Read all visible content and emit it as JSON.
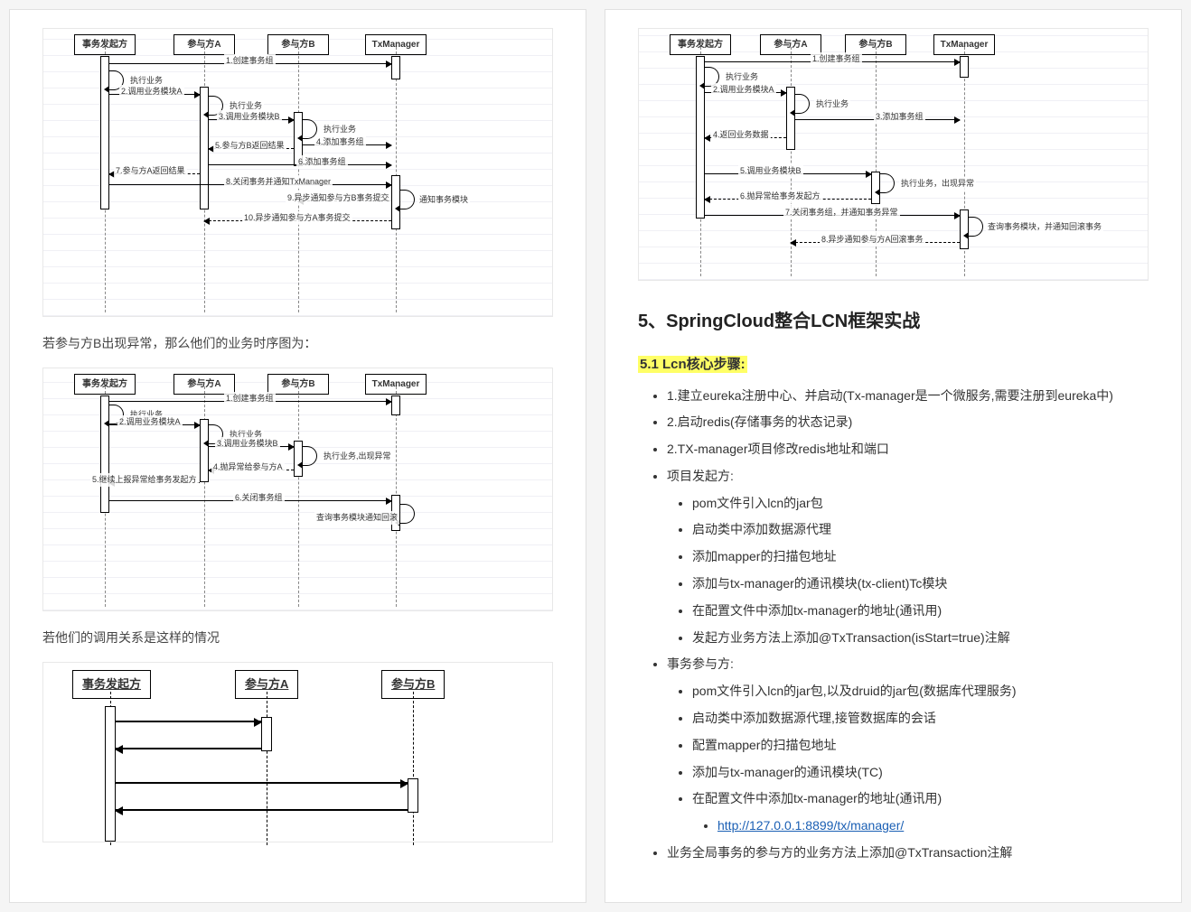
{
  "leftPage": {
    "diagram1": {
      "actors": [
        "事务发起方",
        "参与方A",
        "参与方B",
        "TxManager"
      ],
      "msgs": {
        "m1": "1.创建事务组",
        "m2": "执行业务",
        "m3": "2.调用业务模块A",
        "m4": "执行业务",
        "m5": "3.调用业务模块B",
        "m6": "执行业务",
        "m7": "4.添加事务组",
        "m8": "5.参与方B返回结果",
        "m9": "6.添加事务组",
        "m10": "7.参与方A返回结果",
        "m11": "8.关闭事务并通知TxManager",
        "m12": "9.异步通知参与方B事务提交",
        "m13": "通知事务模块",
        "m14": "10.异步通知参与方A事务提交"
      }
    },
    "para1": "若参与方B出现异常，那么他们的业务时序图为：",
    "diagram2": {
      "actors": [
        "事务发起方",
        "参与方A",
        "参与方B",
        "TxManager"
      ],
      "msgs": {
        "m1": "1.创建事务组",
        "m2": "执行业务",
        "m3": "2.调用业务模块A",
        "m4": "执行业务",
        "m5": "3.调用业务模块B",
        "m6": "执行业务,出现异常",
        "m7": "4.抛异常给参与方A",
        "m8": "5.继续上报异常给事务发起方",
        "m9": "6.关闭事务组",
        "m10": "查询事务模块通知回滚"
      }
    },
    "para2": "若他们的调用关系是这样的情况",
    "diagram3": {
      "actors": [
        "事务发起方",
        "参与方A",
        "参与方B"
      ]
    }
  },
  "rightPage": {
    "diagramRight": {
      "actors": [
        "事务发起方",
        "参与方A",
        "参与方B",
        "TxManager"
      ],
      "msgs": {
        "m1": "1.创建事务组",
        "m2": "执行业务",
        "m3": "2.调用业务模块A",
        "m4": "执行业务",
        "m5": "3.添加事务组",
        "m6": "4.返回业务数据",
        "m7": "5.调用业务模块B",
        "m8": "执行业务，出现异常",
        "m9": "6.抛异常给事务发起方",
        "m10": "7.关闭事务组，并通知事务异常",
        "m11": "查询事务模块，并通知回滚事务",
        "m12": "8.异步通知参与方A回滚事务"
      }
    },
    "sectionTitle": "5、SpringCloud整合LCN框架实战",
    "subTitle": "5.1 Lcn核心步骤:",
    "list": {
      "i1": "1.建立eureka注册中心、并启动(Tx-manager是一个微服务,需要注册到eureka中)",
      "i2": "2.启动redis(存储事务的状态记录)",
      "i3": "2.TX-manager项目修改redis地址和端口",
      "i4": "项目发起方:",
      "i4a": "pom文件引入lcn的jar包",
      "i4b": "启动类中添加数据源代理",
      "i4c": "添加mapper的扫描包地址",
      "i4d": "添加与tx-manager的通讯模块(tx-client)Tc模块",
      "i4e": "在配置文件中添加tx-manager的地址(通讯用)",
      "i4f": "发起方业务方法上添加@TxTransaction(isStart=true)注解",
      "i5": "事务参与方:",
      "i5a": "pom文件引入lcn的jar包,以及druid的jar包(数据库代理服务)",
      "i5b": "启动类中添加数据源代理,接管数据库的会话",
      "i5c": "配置mapper的扫描包地址",
      "i5d": "添加与tx-manager的通讯模块(TC)",
      "i5e": "在配置文件中添加tx-manager的地址(通讯用)",
      "i5eLink": "http://127.0.0.1:8899/tx/manager/",
      "i6": "业务全局事务的参与方的业务方法上添加@TxTransaction注解"
    }
  }
}
